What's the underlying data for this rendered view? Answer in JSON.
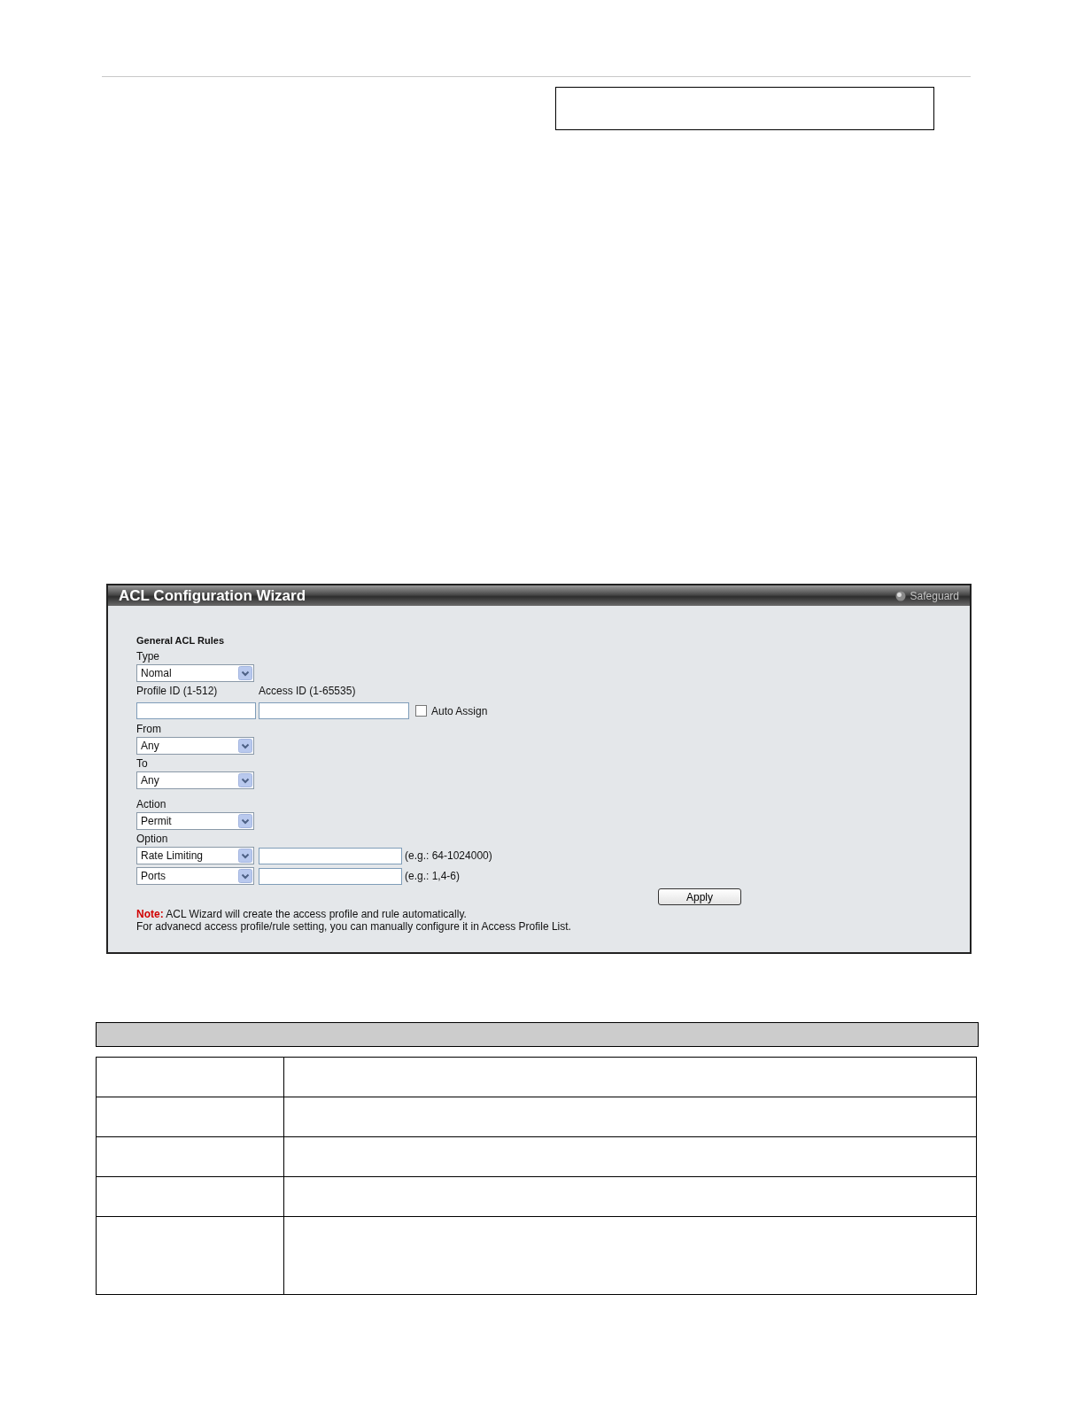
{
  "panel": {
    "title": "ACL Configuration Wizard",
    "status": "Safeguard",
    "section": "General ACL Rules",
    "type": {
      "label": "Type",
      "value": "Nomal"
    },
    "profile_id": {
      "label": "Profile ID (1-512)"
    },
    "access_id": {
      "label": "Access ID (1-65535)"
    },
    "auto_assign": {
      "label": "Auto Assign",
      "checked": false
    },
    "from": {
      "label": "From",
      "value": "Any"
    },
    "to": {
      "label": "To",
      "value": "Any"
    },
    "action": {
      "label": "Action",
      "value": "Permit"
    },
    "option": {
      "label": "Option",
      "rows": [
        {
          "value": "Rate Limiting",
          "hint": "(e.g.: 64-1024000)"
        },
        {
          "value": "Ports",
          "hint": "(e.g.: 1,4-6)"
        }
      ]
    },
    "apply": "Apply",
    "note": {
      "label": "Note:",
      "lines": [
        "ACL Wizard will create the access profile and rule automatically.",
        "For advanecd access profile/rule setting, you can manually configure it in Access Profile List."
      ]
    }
  }
}
